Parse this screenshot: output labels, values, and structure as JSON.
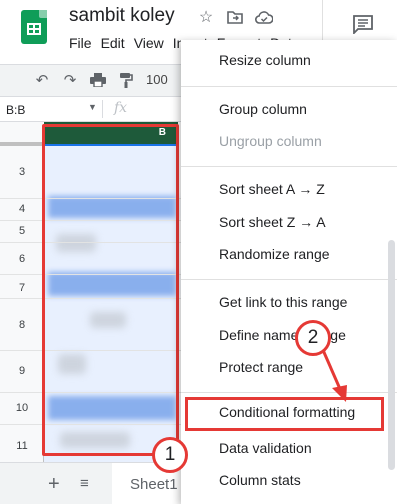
{
  "header": {
    "title": "sambit koley",
    "menu": [
      "File",
      "Edit",
      "View",
      "Insert",
      "Format",
      "Dat"
    ],
    "icons": [
      "star-icon",
      "move-to-folder-icon",
      "cloud-saved-icon",
      "comment-icon"
    ]
  },
  "toolbar": {
    "icons": [
      "undo-icon",
      "redo-icon",
      "print-icon",
      "paint-format-icon"
    ],
    "zoom": "100"
  },
  "formula_bar": {
    "name_box": "B:B",
    "fx": "fx"
  },
  "grid": {
    "column_header": "B",
    "rows": [
      "3",
      "4",
      "5",
      "6",
      "7",
      "8",
      "9",
      "10",
      "11"
    ]
  },
  "bottom": {
    "add": "+",
    "all_sheets": "≡",
    "sheet_tab": "Sheet1"
  },
  "context_menu": {
    "items": [
      {
        "label": "Resize column",
        "disabled": false
      },
      {
        "label": "Group column",
        "disabled": false
      },
      {
        "label": "Ungroup column",
        "disabled": true
      },
      {
        "label": "Sort sheet A → Z",
        "disabled": false
      },
      {
        "label": "Sort sheet Z → A",
        "disabled": false
      },
      {
        "label": "Randomize range",
        "disabled": false
      },
      {
        "label": "Get link to this range",
        "disabled": false
      },
      {
        "label": "Define named range",
        "disabled": false
      },
      {
        "label": "Protect range",
        "disabled": false
      },
      {
        "label": "Conditional formatting",
        "disabled": false
      },
      {
        "label": "Data validation",
        "disabled": false
      },
      {
        "label": "Column stats",
        "disabled": false
      }
    ]
  },
  "callouts": {
    "step1": "1",
    "step2": "2"
  },
  "colors": {
    "highlight": "#e53935",
    "selection": "#e8f0fe",
    "selected_header": "#1e5a3a"
  }
}
